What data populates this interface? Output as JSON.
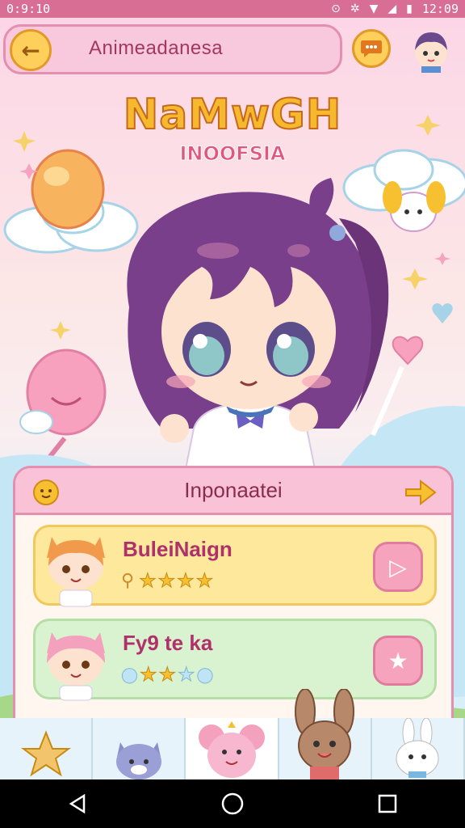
{
  "status_bar": {
    "time": "0:9:10",
    "right_time": "12:09",
    "icons": [
      "notification-icon",
      "signal-icon",
      "wifi-icon",
      "battery-icon"
    ]
  },
  "top_bar": {
    "title": "Animeadanesa",
    "back_icon": "back-arrow-icon",
    "chat_icon": "chat-bubble-icon",
    "avatar_icon": "user-avatar-icon"
  },
  "logo": {
    "main": "NaMwGH",
    "sub": "INOOFSIA"
  },
  "card": {
    "title": "Inponaatei",
    "left_icon": "flower-icon",
    "right_icon": "next-arrow-icon",
    "items": [
      {
        "title": "BuleiNaign",
        "rating": 4,
        "max": 4,
        "action_icon": "play-icon",
        "color": "#fde89c"
      },
      {
        "title": "Fy9 te ka",
        "rating": 2,
        "max": 5,
        "action_icon": "star-icon",
        "color": "#d9f2cf"
      }
    ]
  },
  "bottom_tabs": [
    {
      "icon": "star-tab-icon"
    },
    {
      "icon": "cat-tab-icon"
    },
    {
      "icon": "mouse-tab-icon",
      "active": true
    },
    {
      "icon": "bunny-character-tab-icon"
    },
    {
      "icon": "rabbit-tab-icon"
    }
  ],
  "nav_bar": {
    "buttons": [
      "back-nav-icon",
      "home-nav-icon",
      "recents-nav-icon"
    ]
  },
  "colors": {
    "accent": "#e48fb0",
    "status_bar": "#d96e94",
    "gold": "#f7c031"
  }
}
